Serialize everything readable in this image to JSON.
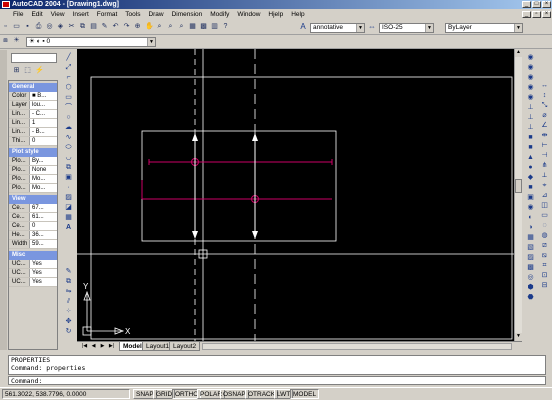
{
  "window": {
    "app": "AutoCAD 2004",
    "document": "[Drawing1.dwg]",
    "title_full": "AutoCAD 2004 - [Drawing1.dwg]"
  },
  "menu": [
    "File",
    "Edit",
    "View",
    "Insert",
    "Format",
    "Tools",
    "Draw",
    "Dimension",
    "Modify",
    "Window",
    "Hjelp",
    "Help"
  ],
  "toolbar": {
    "text_style": "annotative",
    "dim_style": "ISO-25",
    "layer_control": "ByLayer"
  },
  "properties": {
    "sections": [
      {
        "title": "General",
        "rows": [
          [
            "Color",
            "■ B..."
          ],
          [
            "Layer",
            "lou..."
          ],
          [
            "Lin...",
            "- C..."
          ],
          [
            "Lin...",
            "1"
          ],
          [
            "Lin...",
            "- B..."
          ],
          [
            "Thi...",
            "0"
          ]
        ]
      },
      {
        "title": "Plot style",
        "rows": [
          [
            "Plo...",
            "By..."
          ],
          [
            "Plo...",
            "None"
          ],
          [
            "Plo...",
            "Mo..."
          ],
          [
            "Plo...",
            "Mo..."
          ]
        ]
      },
      {
        "title": "View",
        "rows": [
          [
            "Ce...",
            "67..."
          ],
          [
            "Ce...",
            "61..."
          ],
          [
            "Ce...",
            "0"
          ],
          [
            "He...",
            "36..."
          ],
          [
            "Width",
            "59..."
          ]
        ]
      },
      {
        "title": "Misc",
        "rows": [
          [
            "UC...",
            "Yes"
          ],
          [
            "UC...",
            "Yes"
          ],
          [
            "UC...",
            "Yes"
          ]
        ]
      }
    ]
  },
  "tabs": [
    "Model",
    "Layout1",
    "Layout2"
  ],
  "active_tab": "Model",
  "ucs": {
    "x_label": "X",
    "y_label": "Y"
  },
  "command": {
    "history": [
      "PROPERTIES",
      "Command: properties"
    ],
    "prompt": "Command:"
  },
  "status": {
    "coords": "561.3022, 538.7796, 0.0000",
    "buttons": [
      "SNAP",
      "GRID",
      "ORTHO",
      "POLAR",
      "OSNAP",
      "OTRACK",
      "LWT",
      "MODEL"
    ]
  },
  "colors": {
    "canvas": "#000000",
    "magenta": "#cc0066",
    "white": "#ffffff",
    "grey_line": "#808080"
  }
}
